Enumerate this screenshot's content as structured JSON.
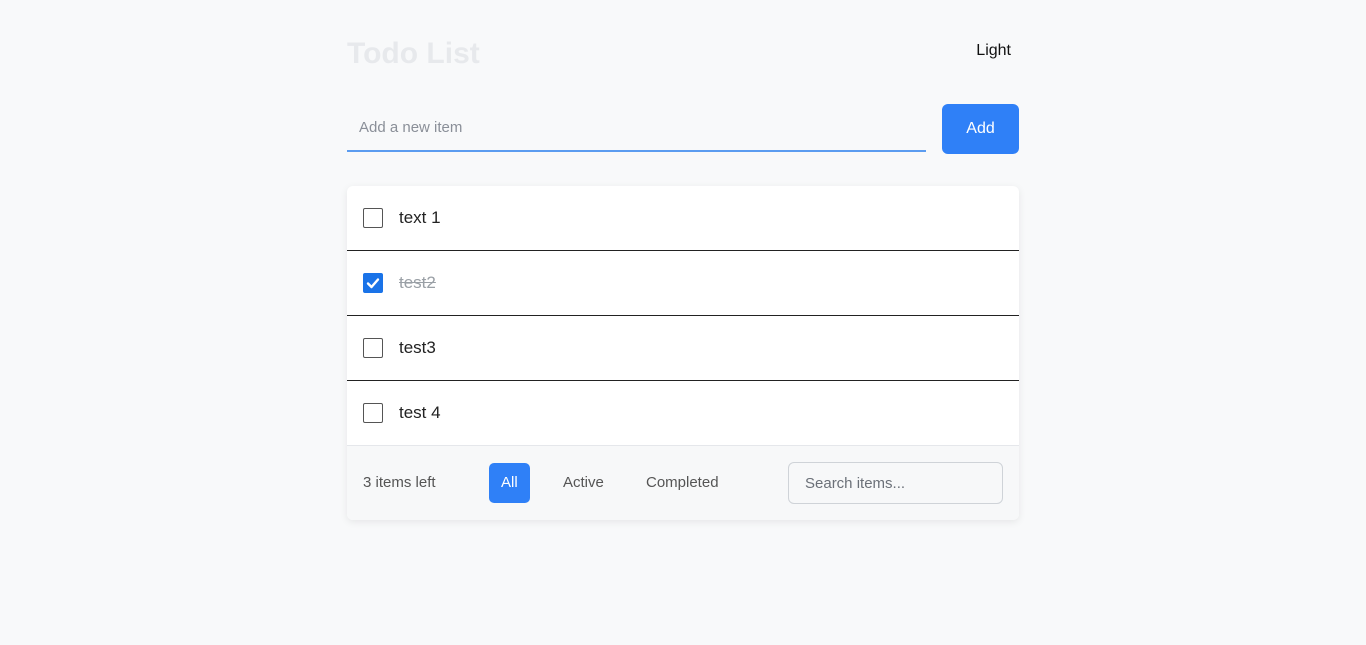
{
  "header": {
    "title": "Todo List",
    "theme_toggle_label": "Light"
  },
  "add_form": {
    "placeholder": "Add a new item",
    "value": "",
    "button_label": "Add"
  },
  "todos": [
    {
      "text": "text 1",
      "completed": false
    },
    {
      "text": "test2",
      "completed": true
    },
    {
      "text": "test3",
      "completed": false
    },
    {
      "text": "test 4",
      "completed": false
    }
  ],
  "footer": {
    "items_left": "3 items left",
    "filters": [
      {
        "label": "All",
        "active": true
      },
      {
        "label": "Active",
        "active": false
      },
      {
        "label": "Completed",
        "active": false
      }
    ],
    "search_placeholder": "Search items...",
    "search_value": ""
  },
  "colors": {
    "accent": "#2f80f7",
    "checkbox_checked": "#1a73e8",
    "background": "#f8f9fa"
  },
  "icons": {
    "checkmark": "check-icon"
  }
}
